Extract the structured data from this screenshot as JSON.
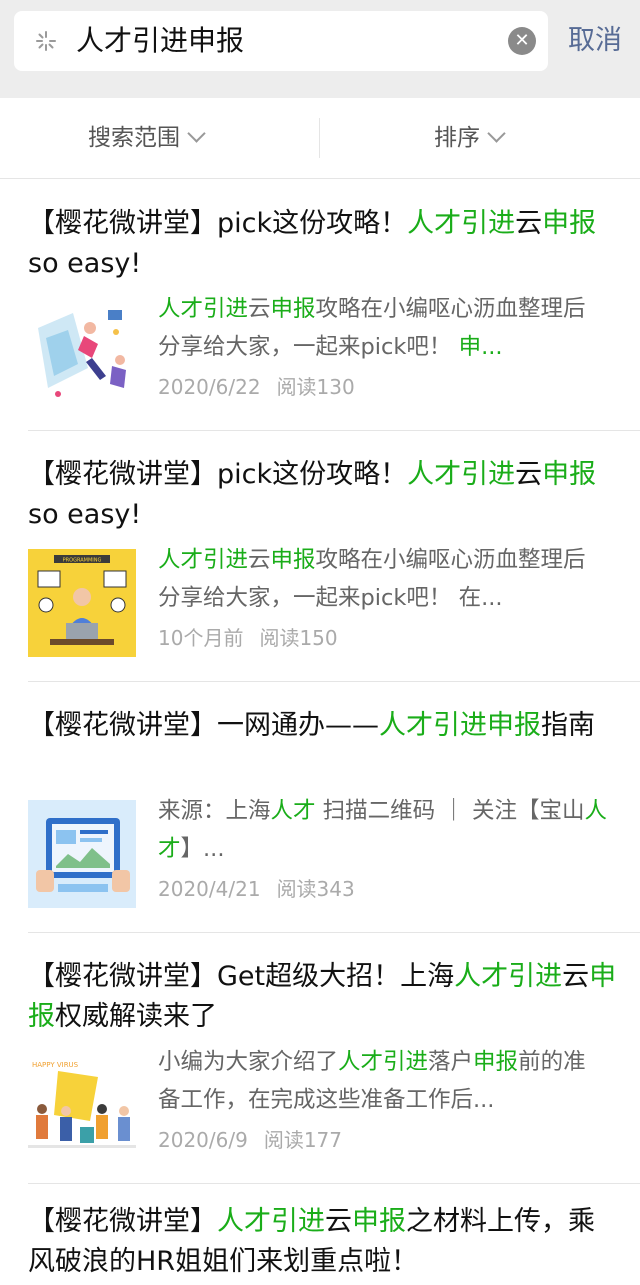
{
  "search": {
    "query": "人才引进申报",
    "cancel_label": "取消"
  },
  "filters": {
    "scope_label": "搜索范围",
    "sort_label": "排序"
  },
  "results": [
    {
      "title": [
        {
          "t": "【樱花微讲堂】pick这份攻略！",
          "hl": false
        },
        {
          "t": "人才引进",
          "hl": true
        },
        {
          "t": "云",
          "hl": false
        },
        {
          "t": "申报",
          "hl": true
        },
        {
          "t": "so easy!",
          "hl": false
        }
      ],
      "snippet": [
        {
          "t": "人才引进",
          "hl": true
        },
        {
          "t": "云",
          "hl": false
        },
        {
          "t": "申报",
          "hl": true
        },
        {
          "t": "攻略在小编呕心沥血整理后分享给大家，一起来pick吧！ ",
          "hl": false
        },
        {
          "t": "申...",
          "hl": true
        }
      ],
      "date": "2020/6/22",
      "reads": "阅读130"
    },
    {
      "title": [
        {
          "t": "【樱花微讲堂】pick这份攻略！",
          "hl": false
        },
        {
          "t": "人才引进",
          "hl": true
        },
        {
          "t": "云",
          "hl": false
        },
        {
          "t": "申报",
          "hl": true
        },
        {
          "t": "so easy!",
          "hl": false
        }
      ],
      "snippet": [
        {
          "t": "人才引进",
          "hl": true
        },
        {
          "t": "云",
          "hl": false
        },
        {
          "t": "申报",
          "hl": true
        },
        {
          "t": "攻略在小编呕心沥血整理后分享给大家，一起来pick吧！ 在...",
          "hl": false
        }
      ],
      "date": "10个月前",
      "reads": "阅读150"
    },
    {
      "title": [
        {
          "t": "【樱花微讲堂】一网通办——",
          "hl": false
        },
        {
          "t": "人才引进申报",
          "hl": true
        },
        {
          "t": "指南",
          "hl": false
        }
      ],
      "snippet": [
        {
          "t": "来源：上海",
          "hl": false
        },
        {
          "t": "人才",
          "hl": true
        },
        {
          "t": " 扫描二维码 ｜ 关注【宝山",
          "hl": false
        },
        {
          "t": "人才",
          "hl": true
        },
        {
          "t": "】...",
          "hl": false
        }
      ],
      "date": "2020/4/21",
      "reads": "阅读343"
    },
    {
      "title": [
        {
          "t": "【樱花微讲堂】Get超级大招！上海",
          "hl": false
        },
        {
          "t": "人才引进",
          "hl": true
        },
        {
          "t": "云",
          "hl": false
        },
        {
          "t": "申报",
          "hl": true
        },
        {
          "t": "权威解读来了",
          "hl": false
        }
      ],
      "snippet": [
        {
          "t": "小编为大家介绍了",
          "hl": false
        },
        {
          "t": "人才引进",
          "hl": true
        },
        {
          "t": "落户",
          "hl": false
        },
        {
          "t": "申报",
          "hl": true
        },
        {
          "t": "前的准备工作，在完成这些准备工作后...",
          "hl": false
        }
      ],
      "date": "2020/6/9",
      "reads": "阅读177"
    },
    {
      "title": [
        {
          "t": "【樱花微讲堂】",
          "hl": false
        },
        {
          "t": "人才引进",
          "hl": true
        },
        {
          "t": "云",
          "hl": false
        },
        {
          "t": "申报",
          "hl": true
        },
        {
          "t": "之材料上传，乘风破浪的HR姐姐们来划重点啦！",
          "hl": false
        }
      ]
    }
  ],
  "thumb_captions": {
    "thumb2": "PROGRAMMING",
    "thumb4": "HAPPY VIRUS"
  },
  "colors": {
    "highlight": "#1aad19",
    "link": "#576b95",
    "meta": "#aaaaaa"
  },
  "icons": [
    "search-icon",
    "clear-icon",
    "chevron-down-icon"
  ]
}
